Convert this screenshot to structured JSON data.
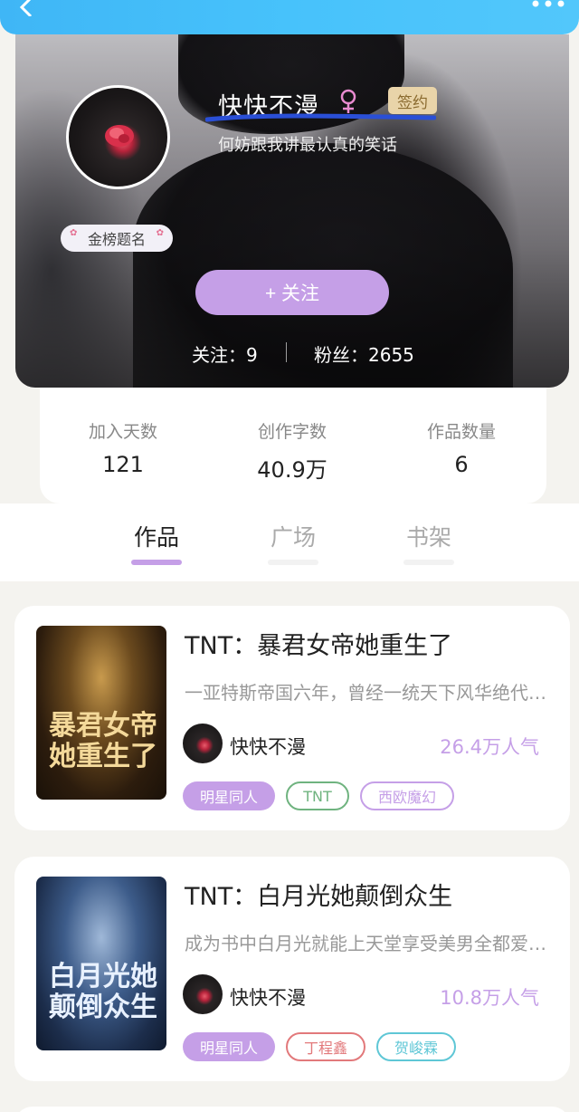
{
  "header": {
    "back_icon": "chevron-left-icon",
    "more_icon": "more-dots-icon"
  },
  "profile": {
    "name": "快快不漫",
    "gender_icon": "female-icon",
    "sign_badge": "签约",
    "bio": "何妨跟我讲最认真的笑话",
    "rank_badge": "金榜题名",
    "follow_button": "+ 关注",
    "following_label": "关注：9",
    "fans_label": "粉丝：2655"
  },
  "stats": [
    {
      "label": "加入天数",
      "value": "121"
    },
    {
      "label": "创作字数",
      "value": "40.9万"
    },
    {
      "label": "作品数量",
      "value": "6"
    }
  ],
  "tabs": [
    {
      "label": "作品",
      "active": true
    },
    {
      "label": "广场",
      "active": false
    },
    {
      "label": "书架",
      "active": false
    }
  ],
  "books": [
    {
      "title": "TNT：暴君女帝她重生了",
      "description": "一亚特斯帝国六年，曾经一统天下风华绝代的女帝",
      "author": "快快不漫",
      "popularity": "26.4万人气",
      "cover_text": "暴君女帝她重生了",
      "tags": [
        {
          "label": "明星同人",
          "style": "filled",
          "color": "#c59fe7"
        },
        {
          "label": "TNT",
          "style": "outline",
          "color": "#6fb37f"
        },
        {
          "label": "西欧魔幻",
          "style": "outline",
          "color": "#c59fe7"
        }
      ]
    },
    {
      "title": "TNT：白月光她颠倒众生",
      "description": "成为书中白月光就能上天堂享受美男全都爱上自己",
      "author": "快快不漫",
      "popularity": "10.8万人气",
      "cover_text": "白月光她颠倒众生",
      "tags": [
        {
          "label": "明星同人",
          "style": "filled",
          "color": "#c59fe7"
        },
        {
          "label": "丁程鑫",
          "style": "outline",
          "color": "#e2797b"
        },
        {
          "label": "贺峻霖",
          "style": "outline",
          "color": "#5fc7d6"
        }
      ]
    }
  ],
  "colors": {
    "accent": "#c59fe7",
    "header": "#47c2fb"
  }
}
